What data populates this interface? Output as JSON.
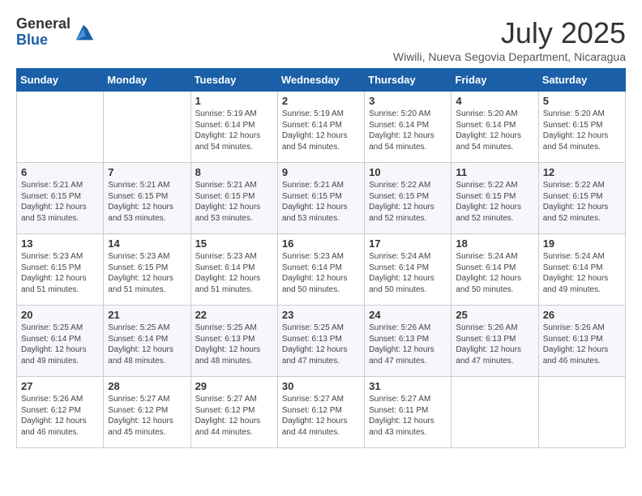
{
  "header": {
    "logo_general": "General",
    "logo_blue": "Blue",
    "month_title": "July 2025",
    "location": "Wiwili, Nueva Segovia Department, Nicaragua"
  },
  "weekdays": [
    "Sunday",
    "Monday",
    "Tuesday",
    "Wednesday",
    "Thursday",
    "Friday",
    "Saturday"
  ],
  "weeks": [
    [
      {
        "day": "",
        "info": ""
      },
      {
        "day": "",
        "info": ""
      },
      {
        "day": "1",
        "info": "Sunrise: 5:19 AM\nSunset: 6:14 PM\nDaylight: 12 hours and 54 minutes."
      },
      {
        "day": "2",
        "info": "Sunrise: 5:19 AM\nSunset: 6:14 PM\nDaylight: 12 hours and 54 minutes."
      },
      {
        "day": "3",
        "info": "Sunrise: 5:20 AM\nSunset: 6:14 PM\nDaylight: 12 hours and 54 minutes."
      },
      {
        "day": "4",
        "info": "Sunrise: 5:20 AM\nSunset: 6:14 PM\nDaylight: 12 hours and 54 minutes."
      },
      {
        "day": "5",
        "info": "Sunrise: 5:20 AM\nSunset: 6:15 PM\nDaylight: 12 hours and 54 minutes."
      }
    ],
    [
      {
        "day": "6",
        "info": "Sunrise: 5:21 AM\nSunset: 6:15 PM\nDaylight: 12 hours and 53 minutes."
      },
      {
        "day": "7",
        "info": "Sunrise: 5:21 AM\nSunset: 6:15 PM\nDaylight: 12 hours and 53 minutes."
      },
      {
        "day": "8",
        "info": "Sunrise: 5:21 AM\nSunset: 6:15 PM\nDaylight: 12 hours and 53 minutes."
      },
      {
        "day": "9",
        "info": "Sunrise: 5:21 AM\nSunset: 6:15 PM\nDaylight: 12 hours and 53 minutes."
      },
      {
        "day": "10",
        "info": "Sunrise: 5:22 AM\nSunset: 6:15 PM\nDaylight: 12 hours and 52 minutes."
      },
      {
        "day": "11",
        "info": "Sunrise: 5:22 AM\nSunset: 6:15 PM\nDaylight: 12 hours and 52 minutes."
      },
      {
        "day": "12",
        "info": "Sunrise: 5:22 AM\nSunset: 6:15 PM\nDaylight: 12 hours and 52 minutes."
      }
    ],
    [
      {
        "day": "13",
        "info": "Sunrise: 5:23 AM\nSunset: 6:15 PM\nDaylight: 12 hours and 51 minutes."
      },
      {
        "day": "14",
        "info": "Sunrise: 5:23 AM\nSunset: 6:15 PM\nDaylight: 12 hours and 51 minutes."
      },
      {
        "day": "15",
        "info": "Sunrise: 5:23 AM\nSunset: 6:14 PM\nDaylight: 12 hours and 51 minutes."
      },
      {
        "day": "16",
        "info": "Sunrise: 5:23 AM\nSunset: 6:14 PM\nDaylight: 12 hours and 50 minutes."
      },
      {
        "day": "17",
        "info": "Sunrise: 5:24 AM\nSunset: 6:14 PM\nDaylight: 12 hours and 50 minutes."
      },
      {
        "day": "18",
        "info": "Sunrise: 5:24 AM\nSunset: 6:14 PM\nDaylight: 12 hours and 50 minutes."
      },
      {
        "day": "19",
        "info": "Sunrise: 5:24 AM\nSunset: 6:14 PM\nDaylight: 12 hours and 49 minutes."
      }
    ],
    [
      {
        "day": "20",
        "info": "Sunrise: 5:25 AM\nSunset: 6:14 PM\nDaylight: 12 hours and 49 minutes."
      },
      {
        "day": "21",
        "info": "Sunrise: 5:25 AM\nSunset: 6:14 PM\nDaylight: 12 hours and 48 minutes."
      },
      {
        "day": "22",
        "info": "Sunrise: 5:25 AM\nSunset: 6:13 PM\nDaylight: 12 hours and 48 minutes."
      },
      {
        "day": "23",
        "info": "Sunrise: 5:25 AM\nSunset: 6:13 PM\nDaylight: 12 hours and 47 minutes."
      },
      {
        "day": "24",
        "info": "Sunrise: 5:26 AM\nSunset: 6:13 PM\nDaylight: 12 hours and 47 minutes."
      },
      {
        "day": "25",
        "info": "Sunrise: 5:26 AM\nSunset: 6:13 PM\nDaylight: 12 hours and 47 minutes."
      },
      {
        "day": "26",
        "info": "Sunrise: 5:26 AM\nSunset: 6:13 PM\nDaylight: 12 hours and 46 minutes."
      }
    ],
    [
      {
        "day": "27",
        "info": "Sunrise: 5:26 AM\nSunset: 6:12 PM\nDaylight: 12 hours and 46 minutes."
      },
      {
        "day": "28",
        "info": "Sunrise: 5:27 AM\nSunset: 6:12 PM\nDaylight: 12 hours and 45 minutes."
      },
      {
        "day": "29",
        "info": "Sunrise: 5:27 AM\nSunset: 6:12 PM\nDaylight: 12 hours and 44 minutes."
      },
      {
        "day": "30",
        "info": "Sunrise: 5:27 AM\nSunset: 6:12 PM\nDaylight: 12 hours and 44 minutes."
      },
      {
        "day": "31",
        "info": "Sunrise: 5:27 AM\nSunset: 6:11 PM\nDaylight: 12 hours and 43 minutes."
      },
      {
        "day": "",
        "info": ""
      },
      {
        "day": "",
        "info": ""
      }
    ]
  ]
}
